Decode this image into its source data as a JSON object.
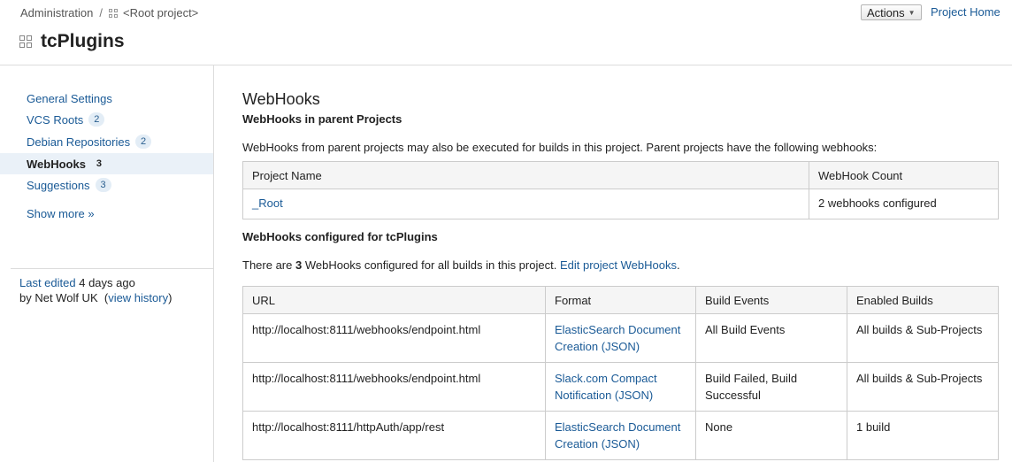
{
  "header": {
    "breadcrumb": {
      "admin": "Administration",
      "separator": "/",
      "root_project": "<Root project>"
    },
    "title": "tcPlugins",
    "actions_label": "Actions",
    "project_home": "Project Home"
  },
  "sidebar": {
    "items": [
      {
        "label": "General Settings",
        "count": ""
      },
      {
        "label": "VCS Roots",
        "count": "2"
      },
      {
        "label": "Debian Repositories",
        "count": "2"
      },
      {
        "label": "WebHooks",
        "count": "3",
        "active": true
      },
      {
        "label": "Suggestions",
        "count": "3"
      }
    ],
    "show_more": "Show more »",
    "last_edited_link": "Last edited",
    "last_edited_when": "4 days ago",
    "by_user": "by Net Wolf UK",
    "view_history": "view history"
  },
  "main": {
    "heading": "WebHooks",
    "parent_heading": "WebHooks in parent Projects",
    "parent_text": "WebHooks from parent projects may also be executed for builds in this project. Parent projects have the following webhooks:",
    "parent_table": {
      "headers": [
        "Project Name",
        "WebHook Count"
      ],
      "rows": [
        {
          "project": "_Root",
          "count": "2 webhooks configured"
        }
      ]
    },
    "configured_heading": "WebHooks configured for tcPlugins",
    "configured_text_pre": "There are",
    "configured_count": "3",
    "configured_text_post": "WebHooks configured for all builds in this project.",
    "edit_link": "Edit project WebHooks",
    "webhooks_table": {
      "headers": [
        "URL",
        "Format",
        "Build Events",
        "Enabled Builds"
      ],
      "rows": [
        {
          "url": "http://localhost:8111/webhooks/endpoint.html",
          "format": "ElasticSearch Document Creation (JSON)",
          "events": "All Build Events",
          "builds": "All builds & Sub-Projects"
        },
        {
          "url": "http://localhost:8111/webhooks/endpoint.html",
          "format": "Slack.com Compact Notification (JSON)",
          "events": "Build Failed, Build Successful",
          "builds": "All builds & Sub-Projects"
        },
        {
          "url": "http://localhost:8111/httpAuth/app/rest",
          "format": "ElasticSearch Document Creation (JSON)",
          "events": "None",
          "builds": "1 build"
        }
      ]
    }
  },
  "colors": {
    "link": "#1a5a96",
    "active_bg": "#eaf1f8",
    "border": "#cccccc"
  }
}
